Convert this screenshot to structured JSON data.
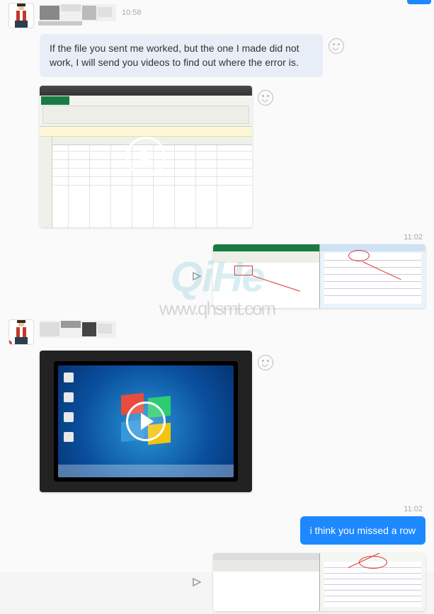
{
  "watermark": {
    "brand": "QiHe",
    "url": "www.qhsmt.com"
  },
  "messages": {
    "m1": {
      "sender_time": "10:58",
      "text": "If the file you sent me worked, but the one I made did not work, I will send you videos to find out where the error is."
    },
    "m2": {
      "type": "video",
      "caption": "Excel screen recording"
    },
    "m3": {
      "time": "11:02",
      "type": "image",
      "caption": "Side-by-side spreadsheet comparison"
    },
    "m4": {
      "type": "video",
      "caption": "Windows 7 desktop photo"
    },
    "m5": {
      "time": "11:02",
      "text": "i think you missed a row"
    },
    "m6": {
      "type": "image",
      "caption": "Side-by-side spreadsheet comparison with circled row"
    }
  }
}
